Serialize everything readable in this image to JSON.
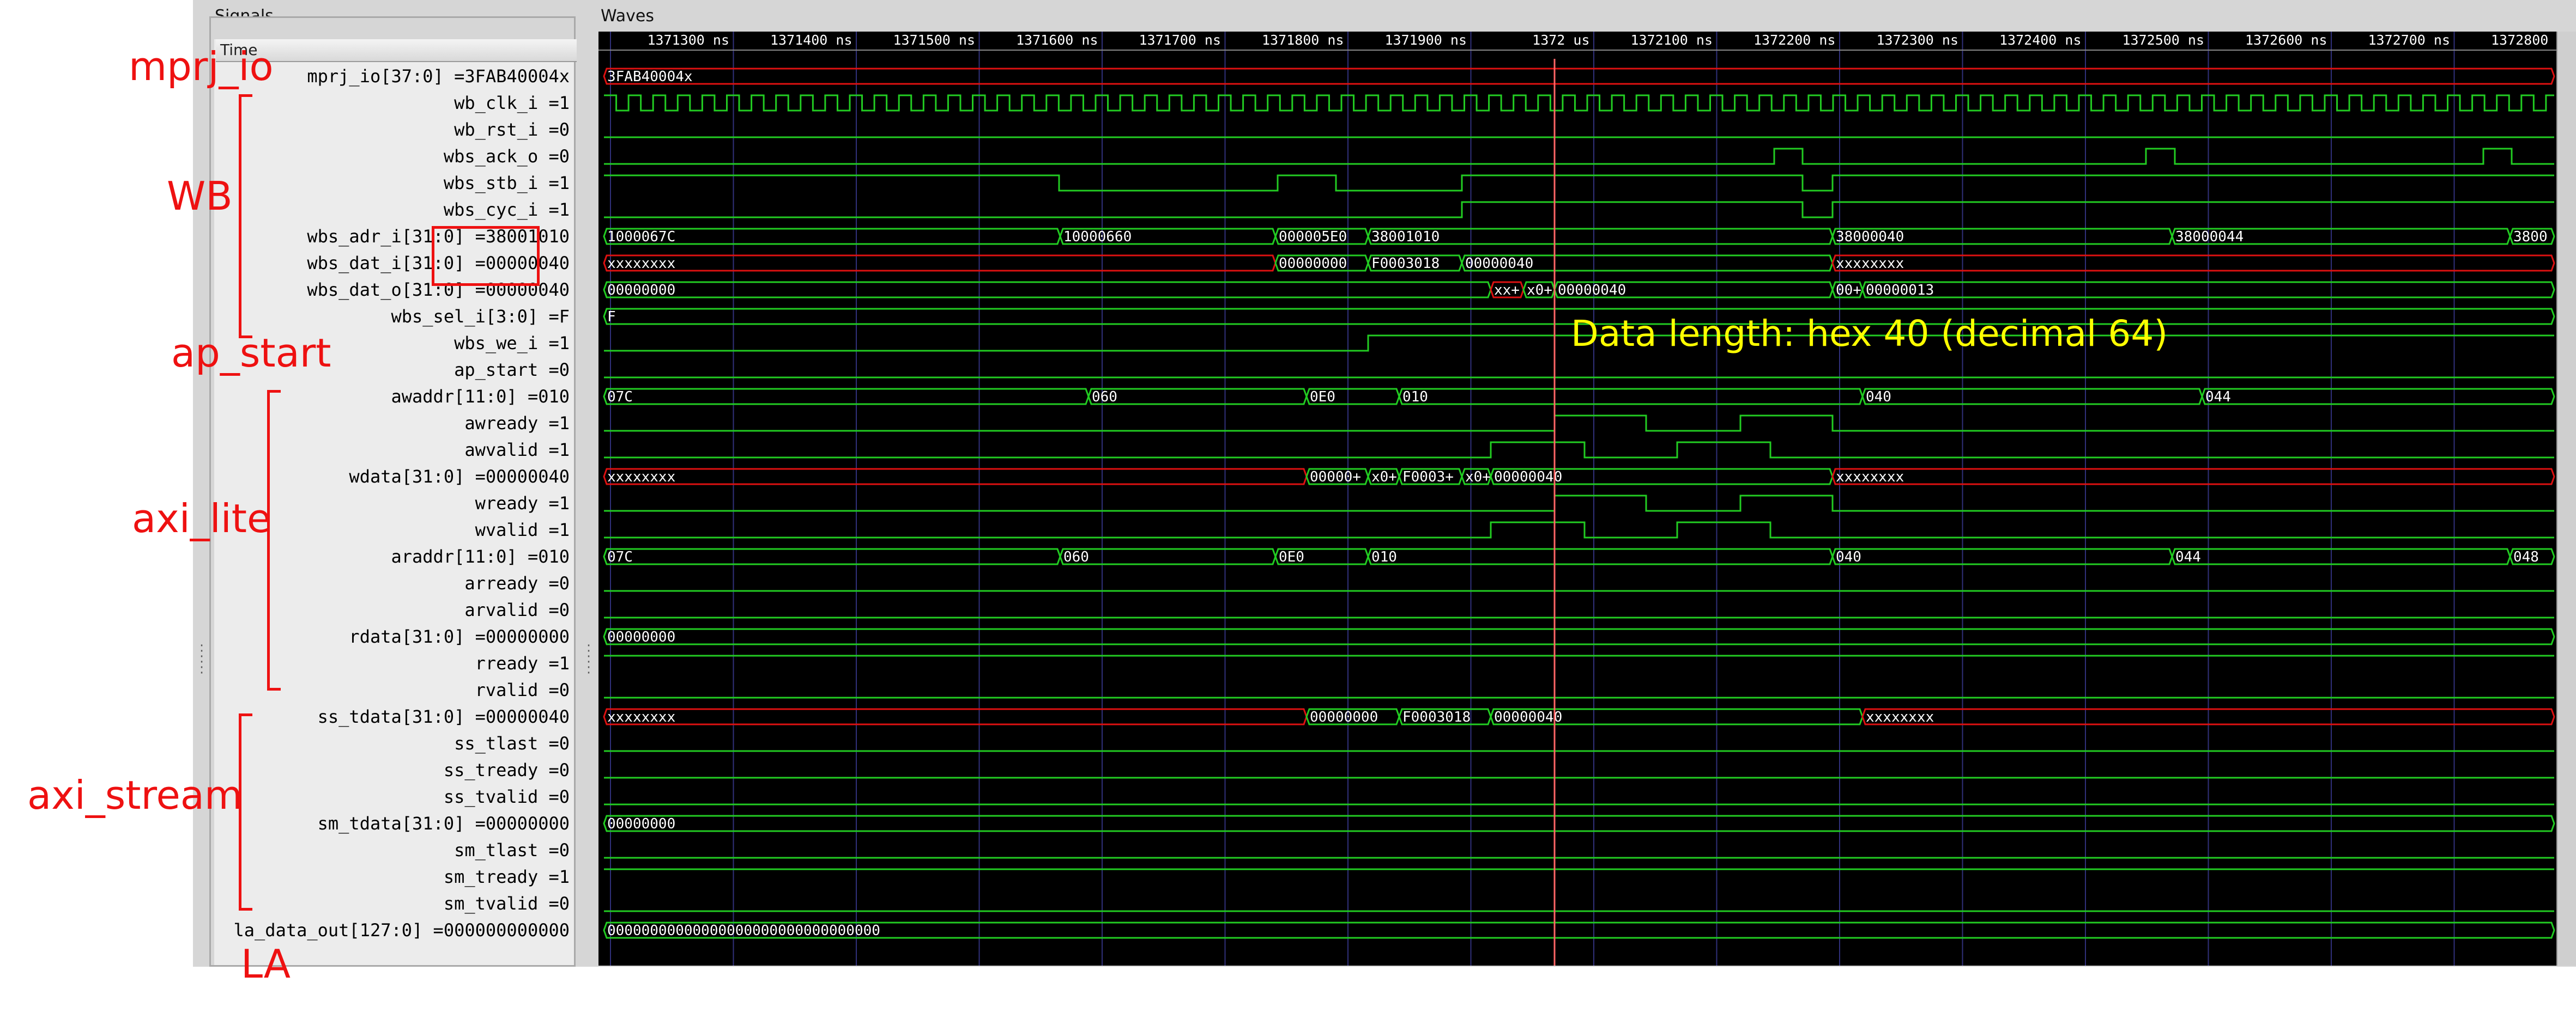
{
  "panels": {
    "signals_title": "Signals",
    "waves_title": "Waves",
    "time_header": "Time"
  },
  "time_ticks": [
    "1371300 ns",
    "1371400 ns",
    "1371500 ns",
    "1371600 ns",
    "1371700 ns",
    "1371800 ns",
    "1371900 ns",
    "1372 us",
    "1372100 ns",
    "1372200 ns",
    "1372300 ns",
    "1372400 ns",
    "1372500 ns",
    "1372600 ns",
    "1372700 ns",
    "1372800 ns"
  ],
  "signals": [
    {
      "name": "mprj_io[37:0]",
      "value": "3FAB40004x"
    },
    {
      "name": "wb_clk_i",
      "value": "1"
    },
    {
      "name": "wb_rst_i",
      "value": "0"
    },
    {
      "name": "wbs_ack_o",
      "value": "0"
    },
    {
      "name": "wbs_stb_i",
      "value": "1"
    },
    {
      "name": "wbs_cyc_i",
      "value": "1"
    },
    {
      "name": "wbs_adr_i[31:0]",
      "value": "38001010"
    },
    {
      "name": "wbs_dat_i[31:0]",
      "value": "00000040"
    },
    {
      "name": "wbs_dat_o[31:0]",
      "value": "00000040"
    },
    {
      "name": "wbs_sel_i[3:0]",
      "value": "F"
    },
    {
      "name": "wbs_we_i",
      "value": "1"
    },
    {
      "name": "ap_start",
      "value": "0"
    },
    {
      "name": "awaddr[11:0]",
      "value": "010"
    },
    {
      "name": "awready",
      "value": "1"
    },
    {
      "name": "awvalid",
      "value": "1"
    },
    {
      "name": "wdata[31:0]",
      "value": "00000040"
    },
    {
      "name": "wready",
      "value": "1"
    },
    {
      "name": "wvalid",
      "value": "1"
    },
    {
      "name": "araddr[11:0]",
      "value": "010"
    },
    {
      "name": "arready",
      "value": "0"
    },
    {
      "name": "arvalid",
      "value": "0"
    },
    {
      "name": "rdata[31:0]",
      "value": "00000000"
    },
    {
      "name": "rready",
      "value": "1"
    },
    {
      "name": "rvalid",
      "value": "0"
    },
    {
      "name": "ss_tdata[31:0]",
      "value": "00000040"
    },
    {
      "name": "ss_tlast",
      "value": "0"
    },
    {
      "name": "ss_tready",
      "value": "0"
    },
    {
      "name": "ss_tvalid",
      "value": "0"
    },
    {
      "name": "sm_tdata[31:0]",
      "value": "00000000"
    },
    {
      "name": "sm_tlast",
      "value": "0"
    },
    {
      "name": "sm_tready",
      "value": "1"
    },
    {
      "name": "sm_tvalid",
      "value": "0"
    },
    {
      "name": "la_data_out[127:0]",
      "value": "000000000000"
    }
  ],
  "annotations": {
    "mprj_io": "mprj_io",
    "wb": "WB",
    "ap_start": "ap_start",
    "axi_lite": "axi_lite",
    "axi_stream": "axi_stream",
    "la": "LA",
    "data_length": "Data length: hex 40 (decimal 64)"
  },
  "waves": {
    "mprj_io": [
      "3FAB40004x"
    ],
    "wbs_adr_i": [
      "1000067C",
      "10000660",
      "000005E0",
      "38001010",
      "38000040",
      "38000044",
      "3800"
    ],
    "wbs_dat_i": [
      "xxxxxxxx",
      "00000000",
      "F0003018",
      "00000040",
      "xxxxxxxx"
    ],
    "wbs_dat_o": [
      "00000000",
      "xx+",
      "x0+",
      "00000040",
      "00+",
      "00000013"
    ],
    "wbs_sel_i": [
      "F"
    ],
    "awaddr": [
      "07C",
      "060",
      "0E0",
      "010",
      "040",
      "044"
    ],
    "wdata": [
      "xxxxxxxx",
      "00000+",
      "x0+",
      "F0003+",
      "x0+",
      "00000040",
      "xxxxxxxx"
    ],
    "araddr": [
      "07C",
      "060",
      "0E0",
      "010",
      "040",
      "044",
      "048"
    ],
    "rdata": [
      "00000000"
    ],
    "ss_tdata": [
      "xxxxxxxx",
      "00000000",
      "F0003018",
      "00000040",
      "xxxxxxxx"
    ],
    "sm_tdata": [
      "00000000"
    ],
    "la_data_out": [
      "00000000000000000000000000000000"
    ]
  },
  "colors": {
    "wave": "#22cc22",
    "undefined": "#dd1111",
    "annotation": "#ee1111",
    "marker": "#ff6666",
    "note": "#ffff00",
    "grid": "#30307a"
  }
}
